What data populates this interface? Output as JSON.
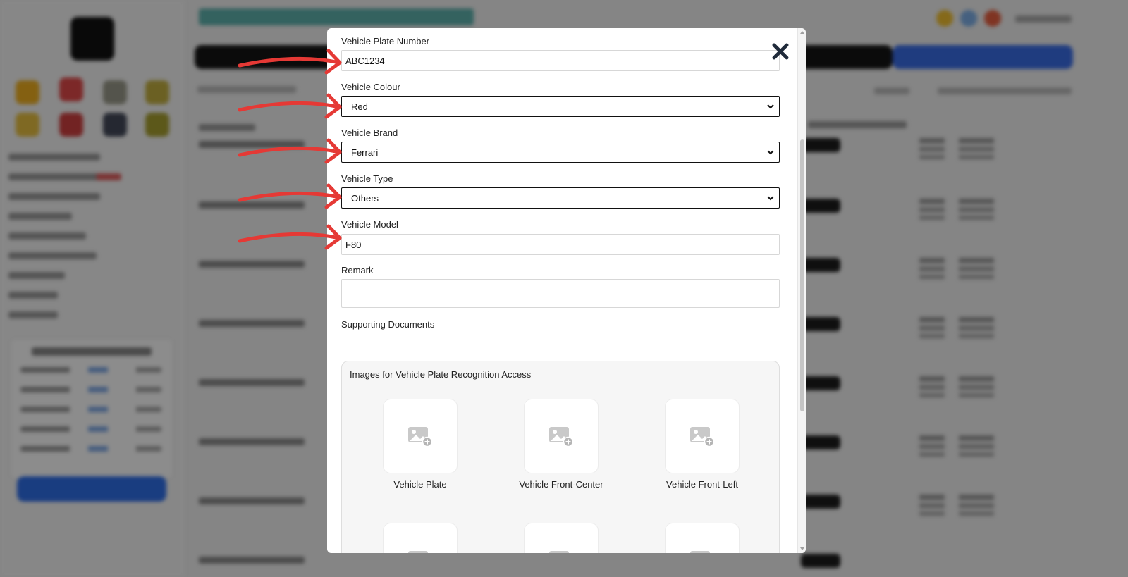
{
  "form": {
    "plate_label": "Vehicle Plate Number",
    "plate_value": "ABC1234",
    "colour_label": "Vehicle Colour",
    "colour_value": "Red",
    "brand_label": "Vehicle Brand",
    "brand_value": "Ferrari",
    "type_label": "Vehicle Type",
    "type_value": "Others",
    "model_label": "Vehicle Model",
    "model_value": "F80",
    "remark_label": "Remark",
    "remark_value": "",
    "docs_label": "Supporting Documents",
    "docs_box_title": "Images for Vehicle Plate Recognition Access",
    "photos": [
      {
        "label": "Vehicle Plate"
      },
      {
        "label": "Vehicle Front-Center"
      },
      {
        "label": "Vehicle Front-Left"
      },
      {
        "label": ""
      },
      {
        "label": ""
      },
      {
        "label": ""
      }
    ]
  },
  "icons": {
    "close": "close-icon",
    "chevron": "chevron-down-icon",
    "photo_add": "add-photo-icon",
    "annotation": "red-arrow"
  },
  "colors": {
    "overlay": "#000000",
    "annotation_arrow": "#e53935",
    "close_icon": "#1f2a3a",
    "accent_blue": "#3a6de8"
  }
}
